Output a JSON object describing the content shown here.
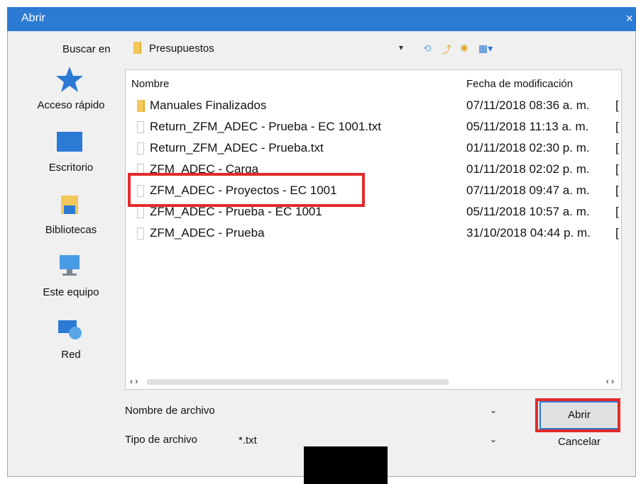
{
  "window": {
    "title": "Abrir",
    "close": "×"
  },
  "lookin": {
    "label": "Buscar en",
    "value": "Presupuestos"
  },
  "toolbar": {
    "icons": [
      "back-icon",
      "up-folder-icon",
      "new-folder-icon",
      "view-menu-icon"
    ]
  },
  "places": [
    {
      "label": "Acceso rápido",
      "icon": "star-icon"
    },
    {
      "label": "Escritorio",
      "icon": "desktop-icon"
    },
    {
      "label": "Bibliotecas",
      "icon": "libraries-icon"
    },
    {
      "label": "Este equipo",
      "icon": "computer-icon"
    },
    {
      "label": "Red",
      "icon": "network-icon"
    }
  ],
  "list": {
    "columns": [
      "Nombre",
      "Fecha de modificación"
    ],
    "rows": [
      {
        "name": "Manuales Finalizados",
        "date": "07/11/2018 08:36 a. m.",
        "type": "folder"
      },
      {
        "name": "Return_ZFM_ADEC - Prueba - EC 1001.txt",
        "date": "05/11/2018 11:13 a. m.",
        "type": "file"
      },
      {
        "name": "Return_ZFM_ADEC - Prueba.txt",
        "date": "01/11/2018 02:30 p. m.",
        "type": "file"
      },
      {
        "name": "ZFM_ADEC - Carga",
        "date": "01/11/2018 02:02 p. m.",
        "type": "file"
      },
      {
        "name": "ZFM_ADEC - Proyectos - EC 1001",
        "date": "07/11/2018 09:47 a. m.",
        "type": "file"
      },
      {
        "name": "ZFM_ADEC - Prueba - EC 1001",
        "date": "05/11/2018 10:57 a. m.",
        "type": "file"
      },
      {
        "name": "ZFM_ADEC - Prueba",
        "date": "31/10/2018 04:44 p. m.",
        "type": "file"
      }
    ],
    "trunc_char": "[",
    "scroll_left": "‹ ›",
    "scroll_right": "‹ ›"
  },
  "filename": {
    "label": "Nombre de archivo",
    "value": ""
  },
  "filetype": {
    "label": "Tipo de archivo",
    "value": "*.txt"
  },
  "buttons": {
    "open": "Abrir",
    "cancel": "Cancelar"
  },
  "colors": {
    "accent": "#2b7ad3",
    "highlight": "#e32a2a"
  }
}
